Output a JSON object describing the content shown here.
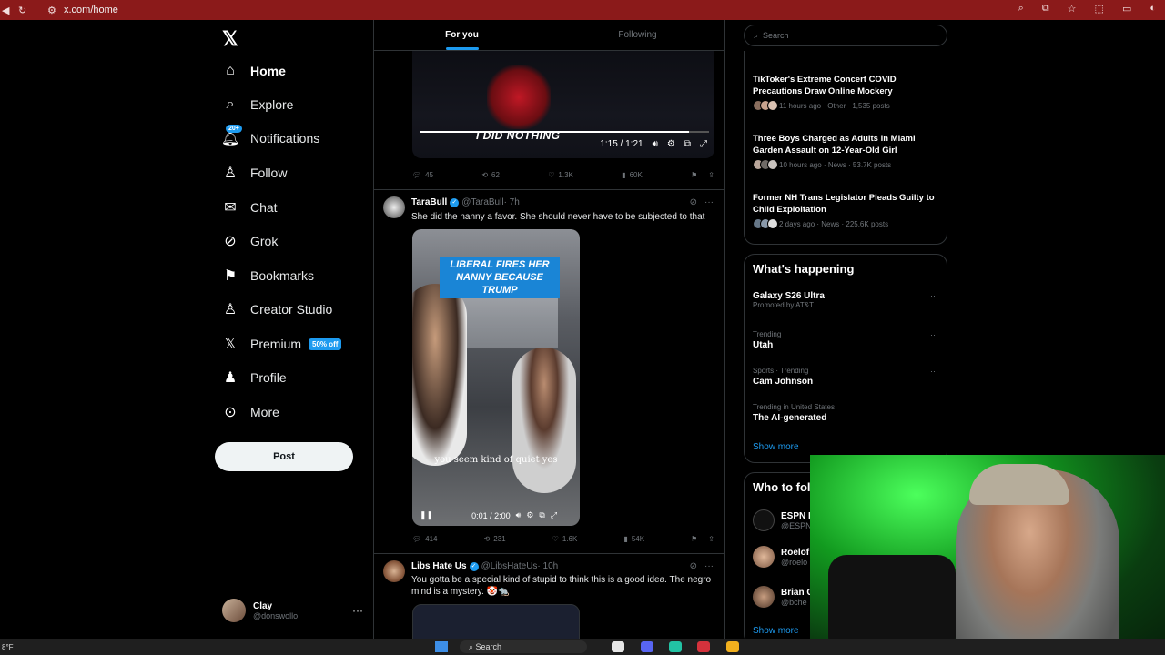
{
  "browser": {
    "url": "x.com/home"
  },
  "nav": {
    "items": [
      {
        "label": "Home",
        "icon": "home-icon"
      },
      {
        "label": "Explore",
        "icon": "search-icon"
      },
      {
        "label": "Notifications",
        "icon": "bell-icon",
        "badge": "20+"
      },
      {
        "label": "Follow",
        "icon": "follow-icon"
      },
      {
        "label": "Chat",
        "icon": "mail-icon"
      },
      {
        "label": "Grok",
        "icon": "grok-icon"
      },
      {
        "label": "Bookmarks",
        "icon": "bookmark-icon"
      },
      {
        "label": "Creator Studio",
        "icon": "creator-studio-icon"
      },
      {
        "label": "Premium",
        "icon": "x-icon",
        "badge": "50% off"
      },
      {
        "label": "Profile",
        "icon": "profile-icon"
      },
      {
        "label": "More",
        "icon": "more-icon"
      }
    ],
    "post_label": "Post",
    "account": {
      "name": "Clay",
      "handle": "@donswollo"
    }
  },
  "feed": {
    "tabs": [
      "For you",
      "Following"
    ],
    "video1": {
      "caption": "I DID NOTHING",
      "time": "1:15 / 1:21",
      "progress": 0.93
    },
    "tweet0_actions": {
      "replies": "45",
      "reposts": "62",
      "likes": "1.3K",
      "views": "60K"
    },
    "tweet1": {
      "name": "TaraBull",
      "handle": "@TaraBull",
      "time": "· 7h",
      "text": "She did the nanny a favor. She should never have to be subjected to that",
      "video_headline": "LIBERAL FIRES HER NANNY BECAUSE TRUMP",
      "video_subtitle": "you seem kind of quiet yes",
      "video_time": "0:01 / 2:00",
      "replies": "414",
      "reposts": "231",
      "likes": "1.6K",
      "views": "54K"
    },
    "tweet2": {
      "name": "Libs Hate Us",
      "handle": "@LibsHateUs",
      "time": "· 10h",
      "text": "You gotta be a special kind of stupid to think this is a good idea. The negro mind is a mystery. 🤡🐀"
    }
  },
  "sidebar": {
    "search_placeholder": "Search",
    "news": [
      {
        "title": "TikToker's Extreme Concert COVID Precautions Draw Online Mockery",
        "meta": "11 hours ago · Other · 1,535 posts"
      },
      {
        "title": "Three Boys Charged as Adults in Miami Garden Assault on 12-Year-Old Girl",
        "meta": "10 hours ago · News · 53.7K posts"
      },
      {
        "title": "Former NH Trans Legislator Pleads Guilty to Child Exploitation",
        "meta": "2 days ago · News · 225.6K posts"
      }
    ],
    "whats_happening_title": "What's happening",
    "trends": [
      {
        "context": "Promoted by AT&T",
        "name": "Galaxy S26 Ultra"
      },
      {
        "context": "Trending",
        "name": "Utah"
      },
      {
        "context": "Sports · Trending",
        "name": "Cam Johnson"
      },
      {
        "context": "Trending in United States",
        "name": "The AI-generated"
      }
    ],
    "show_more": "Show more",
    "who_to_follow_title": "Who to fol",
    "who_to_follow": [
      {
        "name": "ESPN B",
        "handle": "@ESPN"
      },
      {
        "name": "Roelof",
        "handle": "@roelo"
      },
      {
        "name": "Brian C",
        "handle": "@bche"
      }
    ],
    "show_more_2": "Show more"
  },
  "taskbar": {
    "weather": "8°F",
    "search": "Search"
  },
  "colors": {
    "accent": "#1d9bf0",
    "chrome_bar": "#8b1a1a",
    "background": "#000000"
  }
}
